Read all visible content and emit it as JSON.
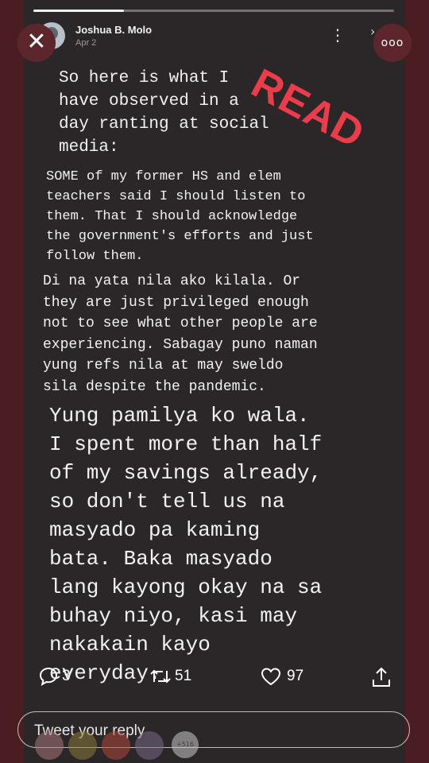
{
  "story": {
    "progress_fraction": 0.25,
    "author": {
      "name": "Joshua B. Molo",
      "date": "Apr 2"
    },
    "stamp_text": "READ",
    "paragraphs": [
      "So here is what I\nhave observed in a\nday ranting at social\nmedia:",
      "SOME of my former HS and elem\nteachers said I should listen to\nthem. That I should acknowledge\nthe government's efforts and just\nfollow them.",
      "Di na yata nila ako kilala. Or\nthey are just privileged enough\nnot to see what other people are\nexperiencing. Sabagay puno naman\nyung refs nila at may sweldo\nsila despite the pandemic.",
      "Yung pamilya ko wala.\nI spent more than half\nof my savings already,\nso don't tell us na\nmasyado pa kaming\nbata. Baka masyado\nlang kayong okay na sa\nbuhay niyo, kasi may\nnakakain kayo\neveryday."
    ]
  },
  "overlay": {
    "close_icon": "close-icon",
    "more_icon": "more-options-icon",
    "more_glyph": "ooo",
    "close_glyph": "✕"
  },
  "actions": {
    "replies": "3",
    "retweets": "51",
    "likes": "97"
  },
  "reply": {
    "placeholder": "Tweet your reply",
    "more_reactors_label": "+516",
    "reactor_colors": [
      "#a8777a",
      "#8a7a3a",
      "#b0463a",
      "#7a6a8a"
    ]
  },
  "colors": {
    "background": "#4a1d22",
    "card": "#2b2627",
    "stamp": "#ea3c4a"
  }
}
